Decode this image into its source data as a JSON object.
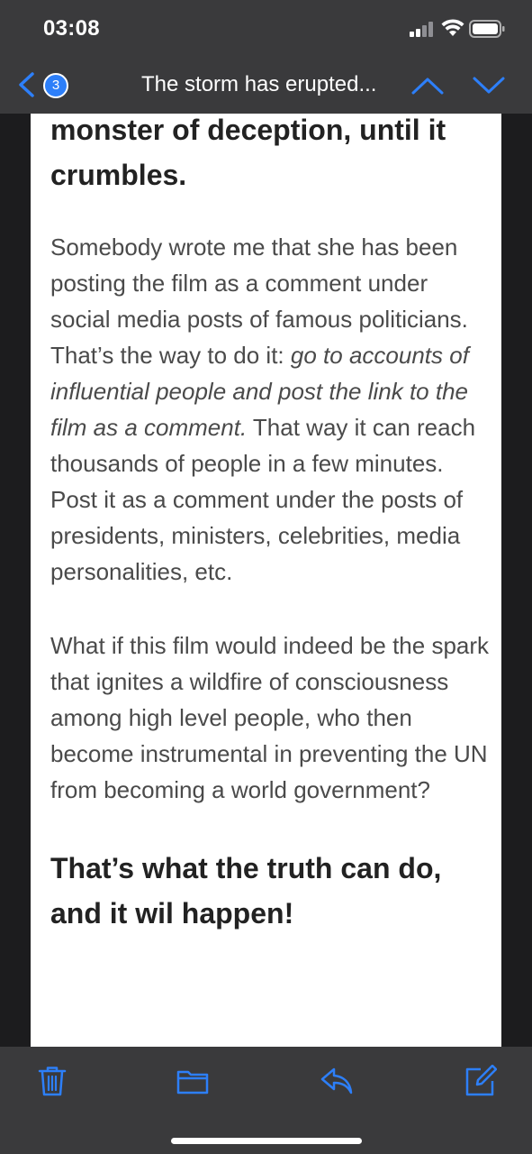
{
  "status_bar": {
    "time": "03:08",
    "icons": [
      "cellular-signal-icon",
      "wifi-icon",
      "battery-icon"
    ]
  },
  "nav": {
    "back_icon": "chevron-left-icon",
    "unread_count": "3",
    "title": "The storm has erupted...",
    "prev_icon": "chevron-up-icon",
    "next_icon": "chevron-down-icon"
  },
  "email": {
    "intro_heading": "monster of deception, until it crumbles.",
    "paragraph_1": {
      "before": "Somebody wrote me that she has been posting the film as a comment under social media posts of famous politicians. That’s the way to do it: ",
      "emphasis": "go to accounts of influential people and post the link to the film as a comment.",
      "after": " That way it can reach thousands of people in a few minutes. Post it as a comment under the posts of presidents, ministers, celebrities, media personalities, etc."
    },
    "paragraph_2": "What if this film would indeed be the spark that ignites a wildfire of consciousness among high level people, who then become instrumental in preventing the UN from becoming a world government?",
    "closing_heading": "That’s what the truth can do, and it wil happen!"
  },
  "toolbar": {
    "icons": [
      "trash-icon",
      "folder-icon",
      "reply-icon",
      "compose-icon"
    ]
  },
  "colors": {
    "accent": "#2d7ff9",
    "bar_background": "#3a3a3c",
    "side_background": "#1c1c1e",
    "body_text": "#4a4a4a"
  }
}
